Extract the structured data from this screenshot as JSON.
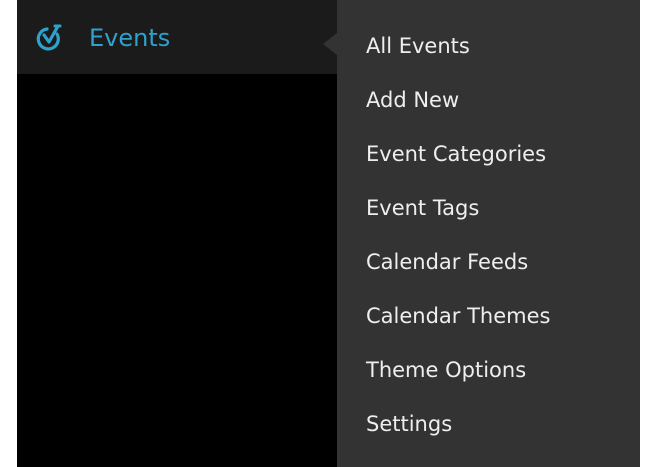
{
  "menu": {
    "top_item": {
      "icon": "events-calendar-icon",
      "label": "Events",
      "color": "#2ea2cc"
    },
    "submenu": [
      {
        "label": "All Events"
      },
      {
        "label": "Add New"
      },
      {
        "label": "Event Categories"
      },
      {
        "label": "Event Tags"
      },
      {
        "label": "Calendar Feeds"
      },
      {
        "label": "Calendar Themes"
      },
      {
        "label": "Theme Options"
      },
      {
        "label": "Settings"
      }
    ]
  },
  "colors": {
    "sidebar_background": "#000000",
    "active_item_background": "#1b1b1b",
    "submenu_background": "#333333",
    "submenu_text": "#eeeeee"
  }
}
